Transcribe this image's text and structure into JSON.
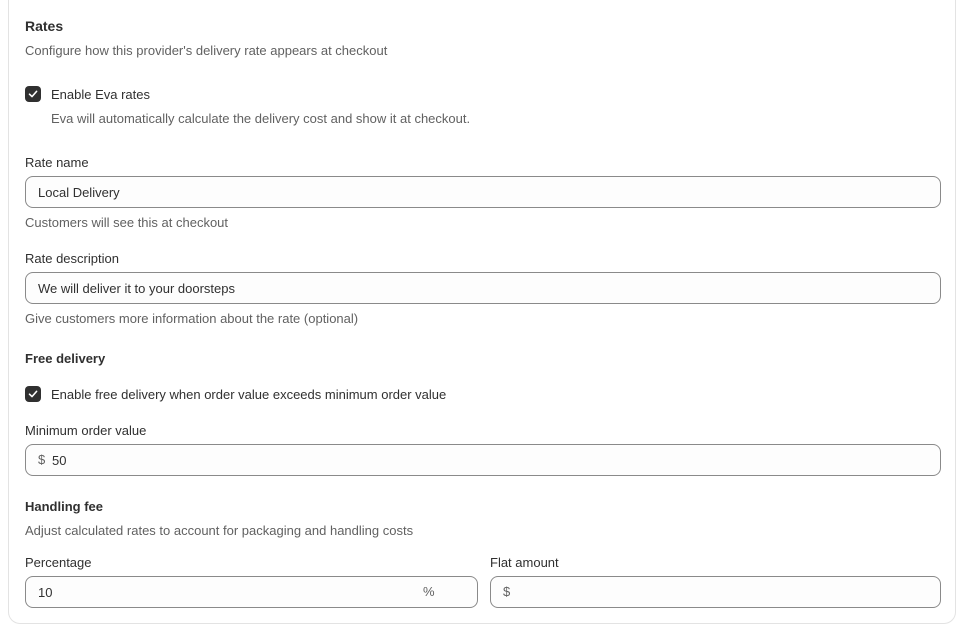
{
  "rates": {
    "title": "Rates",
    "subtitle": "Configure how this provider's delivery rate appears at checkout",
    "enable_checkbox_label": "Enable Eva rates",
    "enable_checkbox_checked": true,
    "enable_help": "Eva will automatically calculate the delivery cost and show it at checkout."
  },
  "rate_name": {
    "label": "Rate name",
    "value": "Local Delivery",
    "help": "Customers will see this at checkout"
  },
  "rate_description": {
    "label": "Rate description",
    "value": "We will deliver it to your doorsteps",
    "help": "Give customers more information about the rate (optional)"
  },
  "free_delivery": {
    "title": "Free delivery",
    "checkbox_label": "Enable free delivery when order value exceeds minimum order value",
    "checkbox_checked": true,
    "min_label": "Minimum order value",
    "min_prefix": "$",
    "min_value": "50"
  },
  "handling_fee": {
    "title": "Handling fee",
    "subtitle": "Adjust calculated rates to account for packaging and handling costs",
    "percentage_label": "Percentage",
    "percentage_value": "10",
    "percentage_suffix": "%",
    "flat_label": "Flat amount",
    "flat_prefix": "$",
    "flat_value": ""
  },
  "colors": {
    "checkbox": "#303030",
    "border": "#8a8a8a",
    "muted_text": "#616161"
  }
}
